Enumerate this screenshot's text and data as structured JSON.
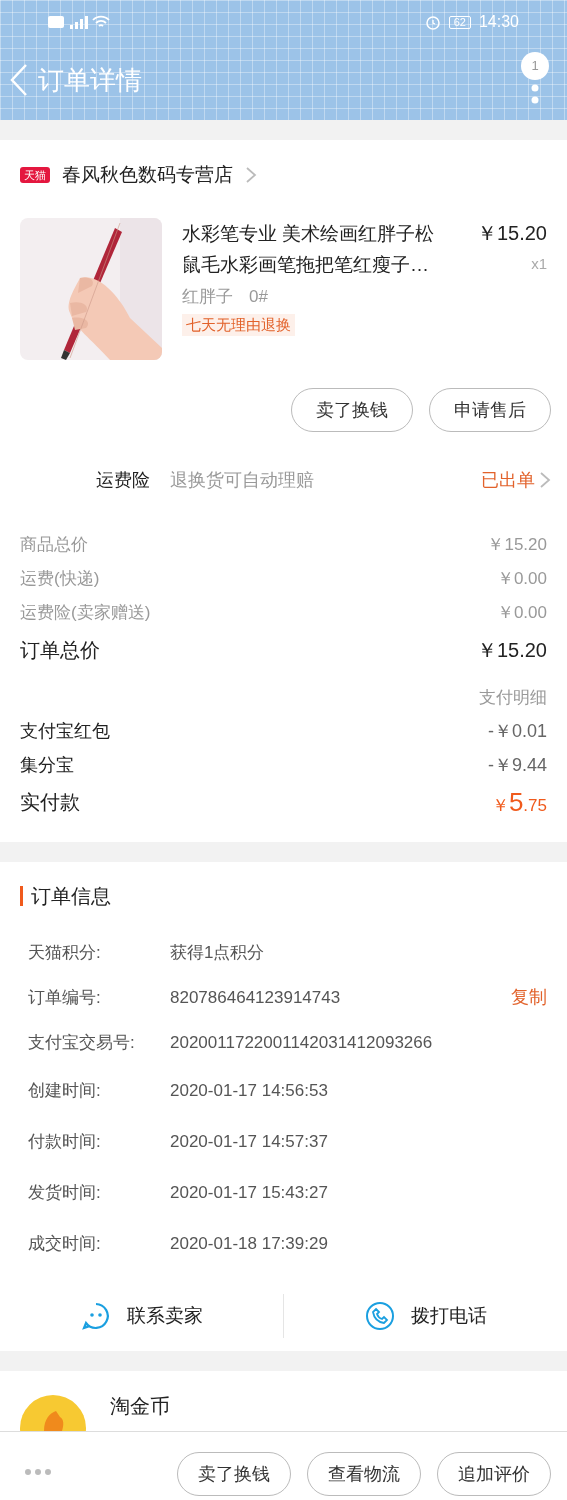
{
  "status_bar": {
    "time": "14:30",
    "battery": "62"
  },
  "header": {
    "title": "订单详情",
    "badge": "1"
  },
  "store": {
    "badge": "天猫",
    "name": "春风秋色数码专营店"
  },
  "product": {
    "title": "水彩笔专业 美术绘画红胖子松鼠毛水彩画笔拖把笔红瘦子…",
    "price": "￥15.20",
    "quantity": "x1",
    "sku": [
      "红胖子",
      "0#"
    ],
    "tag": "七天无理由退换"
  },
  "item_actions": [
    "卖了换钱",
    "申请售后"
  ],
  "insurance": {
    "label": "运费险",
    "desc": "退换货可自动理赔",
    "status": "已出单"
  },
  "price_rows": [
    {
      "label": "商品总价",
      "value": "￥15.20",
      "kind": "minor"
    },
    {
      "label": "运费(快递)",
      "value": "￥0.00",
      "kind": "minor"
    },
    {
      "label": "运费险(卖家赠送)",
      "value": "￥0.00",
      "kind": "minor"
    },
    {
      "label": "订单总价",
      "value": "￥15.20",
      "kind": "total"
    }
  ],
  "payment_detail_title": "支付明细",
  "payment_rows": [
    {
      "label": "支付宝红包",
      "value": "-￥0.01"
    },
    {
      "label": "集分宝",
      "value": "-￥9.44"
    }
  ],
  "paid": {
    "label": "实付款",
    "currency": "￥",
    "integer": "5",
    "decimal": ".75"
  },
  "order_info": {
    "title": "订单信息",
    "rows": [
      {
        "label": "天猫积分:",
        "value": "获得1点积分"
      },
      {
        "label": "订单编号:",
        "value": "820786464123914743",
        "action": "复制"
      },
      {
        "label": "支付宝交易号:",
        "value": "2020011722001142031412093266"
      },
      {
        "label": "创建时间:",
        "value": "2020-01-17 14:56:53"
      },
      {
        "label": "付款时间:",
        "value": "2020-01-17 14:57:37"
      },
      {
        "label": "发货时间:",
        "value": "2020-01-17 15:43:27"
      },
      {
        "label": "成交时间:",
        "value": "2020-01-18 17:39:29"
      }
    ]
  },
  "contact": [
    "联系卖家",
    "拨打电话"
  ],
  "coins": {
    "title": "淘金币"
  },
  "bottom_actions": [
    "卖了换钱",
    "查看物流",
    "追加评价"
  ]
}
